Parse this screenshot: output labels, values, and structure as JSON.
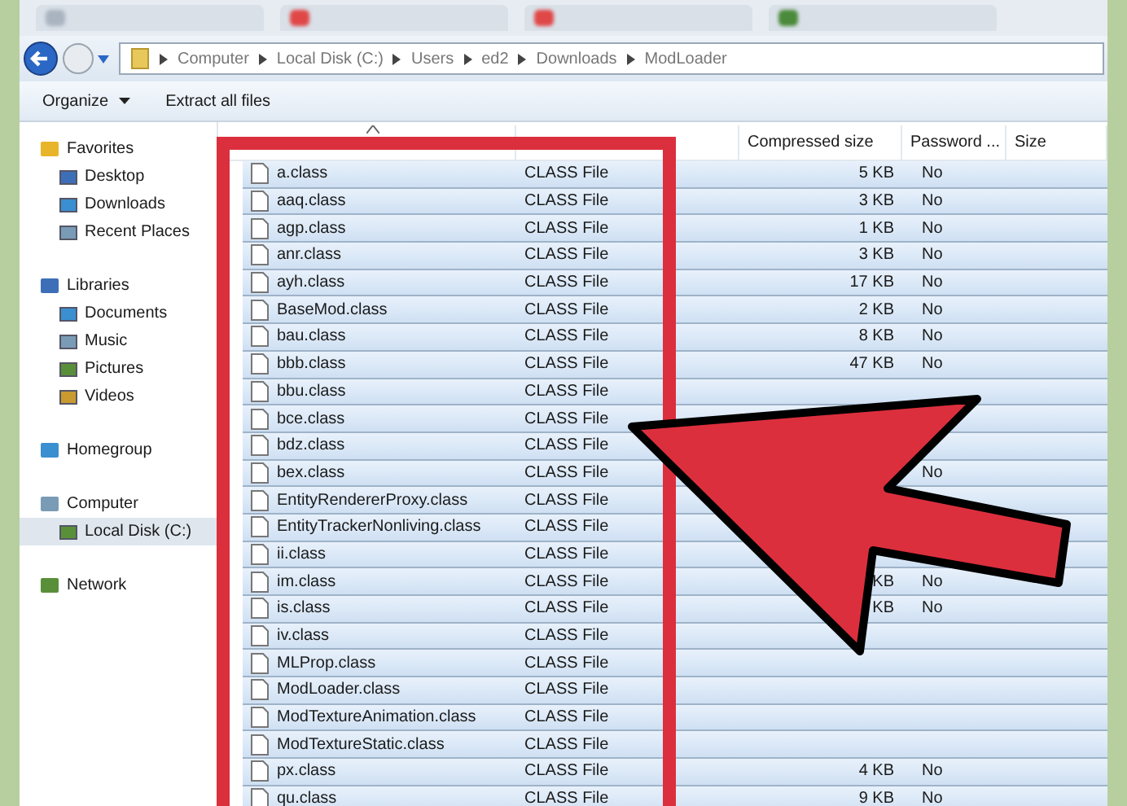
{
  "address_bar": {
    "path": [
      "Computer",
      "Local Disk (C:)",
      "Users",
      "ed2",
      "Downloads",
      "ModLoader"
    ]
  },
  "toolbar": {
    "buttons": [
      {
        "label": "Organize",
        "dropdown": true
      },
      {
        "label": "Extract all files",
        "dropdown": false
      }
    ]
  },
  "sidebar": {
    "groups": [
      {
        "label": "Favorites",
        "children": [
          {
            "label": "Desktop",
            "selected": false
          },
          {
            "label": "Downloads",
            "selected": false
          },
          {
            "label": "Recent Places",
            "selected": false
          }
        ]
      },
      {
        "label": "Libraries",
        "children": [
          {
            "label": "Documents",
            "selected": false
          },
          {
            "label": "Music",
            "selected": false
          },
          {
            "label": "Pictures",
            "selected": false
          },
          {
            "label": "Videos",
            "selected": false
          }
        ]
      },
      {
        "label": "Homegroup"
      },
      {
        "label": "Computer",
        "children": [
          {
            "label": "Local Disk (C:)",
            "selected": true
          }
        ]
      },
      {
        "label": "Network"
      }
    ]
  },
  "table": {
    "columns": [
      "Compressed size",
      "Password ...",
      "Size"
    ],
    "rows": [
      {
        "name": "a.class",
        "type": "CLASS File",
        "compressed": "5 KB",
        "password": "No",
        "selected": true
      },
      {
        "name": "aaq.class",
        "type": "CLASS File",
        "compressed": "3 KB",
        "password": "No",
        "selected": true
      },
      {
        "name": "agp.class",
        "type": "CLASS File",
        "compressed": "1 KB",
        "password": "No",
        "selected": true
      },
      {
        "name": "anr.class",
        "type": "CLASS File",
        "compressed": "3 KB",
        "password": "No",
        "selected": true
      },
      {
        "name": "ayh.class",
        "type": "CLASS File",
        "compressed": "17 KB",
        "password": "No",
        "selected": true
      },
      {
        "name": "BaseMod.class",
        "type": "CLASS File",
        "compressed": "2 KB",
        "password": "No",
        "selected": true
      },
      {
        "name": "bau.class",
        "type": "CLASS File",
        "compressed": "8 KB",
        "password": "No",
        "selected": true
      },
      {
        "name": "bbb.class",
        "type": "CLASS File",
        "compressed": "47 KB",
        "password": "No",
        "selected": true
      },
      {
        "name": "bbu.class",
        "type": "CLASS File",
        "selected": true
      },
      {
        "name": "bce.class",
        "type": "CLASS File",
        "selected": true
      },
      {
        "name": "bdz.class",
        "type": "CLASS File",
        "selected": true
      },
      {
        "name": "bex.class",
        "type": "CLASS File",
        "password": "No",
        "selected": true
      },
      {
        "name": "EntityRendererProxy.class",
        "type": "CLASS File",
        "selected": true
      },
      {
        "name": "EntityTrackerNonliving.class",
        "type": "CLASS File",
        "selected": true
      },
      {
        "name": "ii.class",
        "type": "CLASS File",
        "selected": true
      },
      {
        "name": "im.class",
        "type": "CLASS File",
        "compressed": "KB",
        "password": "No",
        "selected": true
      },
      {
        "name": "is.class",
        "type": "CLASS File",
        "compressed": "KB",
        "password": "No",
        "selected": true
      },
      {
        "name": "iv.class",
        "type": "CLASS File",
        "selected": true
      },
      {
        "name": "MLProp.class",
        "type": "CLASS File",
        "selected": true
      },
      {
        "name": "ModLoader.class",
        "type": "CLASS File",
        "selected": true
      },
      {
        "name": "ModTextureAnimation.class",
        "type": "CLASS File",
        "selected": true
      },
      {
        "name": "ModTextureStatic.class",
        "type": "CLASS File",
        "selected": true
      },
      {
        "name": "px.class",
        "type": "CLASS File",
        "compressed": "4 KB",
        "password": "No",
        "selected": true
      },
      {
        "name": "qu.class",
        "type": "CLASS File",
        "compressed": "9 KB",
        "password": "No",
        "selected": true
      }
    ]
  }
}
